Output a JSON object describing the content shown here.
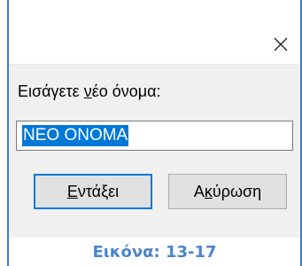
{
  "dialog": {
    "close_glyph": "✕",
    "prompt": {
      "pre": "Εισάγετε ",
      "accel": "ν",
      "post": "έο όνομα:"
    },
    "input_value": "ΝΕΟ ΟΝΟΜΑ",
    "ok_button": {
      "accel": "Ε",
      "rest": "ντάξει"
    },
    "cancel_button": {
      "pre": "Α",
      "accel": "κ",
      "post": "ύρωση"
    },
    "accent_color": "#0078d7"
  },
  "caption": "Εικόνα: 13-17"
}
